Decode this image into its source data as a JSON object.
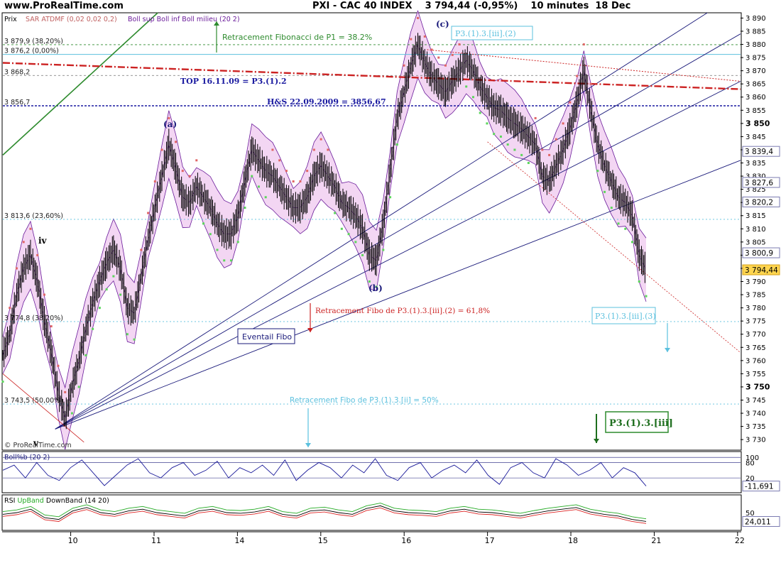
{
  "header": {
    "site": "www.ProRealTime.com",
    "instrument": "PXI - CAC 40 INDEX",
    "last": "3 794,44 (-0,95%)",
    "timeframe": "10 minutes  18 Dec"
  },
  "chart_data": [
    {
      "type": "candlestick",
      "legend": {
        "price": "Prix",
        "sar": "SAR ATDMF (0,02 0,02 0,2)",
        "boll": "Boll sup Boll inf Boll milieu (20 2)"
      },
      "ylim": [
        3726,
        3892
      ],
      "x_ticks": [
        {
          "label": "10",
          "pos": 0.092
        },
        {
          "label": "11",
          "pos": 0.205
        },
        {
          "label": "14",
          "pos": 0.318
        },
        {
          "label": "15",
          "pos": 0.431
        },
        {
          "label": "16",
          "pos": 0.544
        },
        {
          "label": "17",
          "pos": 0.657
        },
        {
          "label": "18",
          "pos": 0.77
        },
        {
          "label": "21",
          "pos": 0.883
        },
        {
          "label": "22",
          "pos": 0.996
        }
      ],
      "y_ticks": [
        "3 730",
        "3 735",
        "3 740",
        "3 745",
        "3 750",
        "3 755",
        "3 760",
        "3 765",
        "3 770",
        "3 775",
        "3 780",
        "3 785",
        "3 790",
        "3 795",
        "3 800",
        "3 805",
        "3 810",
        "3 815",
        "3 820",
        "3 825",
        "3 830",
        "3 835",
        "3 840",
        "3 845",
        "3 850",
        "3 855",
        "3 860",
        "3 865",
        "3 870",
        "3 875",
        "3 880",
        "3 885",
        "3 890"
      ],
      "y_ticks_bold": [
        "3 750",
        "3 850"
      ],
      "right_labels": [
        {
          "value": 3839.4,
          "text": "3 839,4"
        },
        {
          "value": 3827.6,
          "text": "3 827,6"
        },
        {
          "value": 3820.2,
          "text": "3 820,2"
        },
        {
          "value": 3800.9,
          "text": "3 800,9"
        },
        {
          "value": 3794.44,
          "text": "3 794,44",
          "highlight": true
        }
      ],
      "levels": [
        {
          "value": 3879.9,
          "text": "3 879,9 (38,20%)",
          "color": "#2e8b2e",
          "dash": "3,3"
        },
        {
          "value": 3876.2,
          "text": "3 876,2 (0,00%)",
          "color": "#5bc0de",
          "dash": ""
        },
        {
          "value": 3868.2,
          "text": "3 868,2",
          "color": "#888888",
          "dash": "3,3"
        },
        {
          "value": 3856.7,
          "text": "3 856,7",
          "color": "#1a1aa0",
          "dash": "3,2"
        },
        {
          "value": 3813.6,
          "text": "3 813,6 (23,60%)",
          "color": "#5bc0de",
          "dash": "2,3"
        },
        {
          "value": 3774.8,
          "text": "3 774,8 (38,20%)",
          "color": "#5bc0de",
          "dash": "2,3"
        },
        {
          "value": 3743.5,
          "text": "3 743,5 (50,00%)",
          "color": "#5bc0de",
          "dash": "2,3"
        }
      ],
      "annotations": {
        "fibo_p1": "Retracement Fibonacci de P1 = 38.2%",
        "top": "TOP 16.11.09 = P3.(1).2",
        "hs": "H&S 22.09.2009 = 3856,67",
        "fibo_618": "Retracement Fibo de P3.(1).3.[iii].(2) = 61,8%",
        "fibo_50": "Retracement Fibo de P3.(1).3.[ii] = 50%",
        "eventail": "Eventail Fibo",
        "wave_c": "(c)",
        "wave_a": "(a)",
        "wave_b": "(b)",
        "wave_iv": "iv",
        "wave_v": "v",
        "box_c": "P3.(1).3.[iii].(2)",
        "box_3": "P3.(1).3.[iii].(3)",
        "box_iii": "P3.(1).3.[iii]",
        "copyright": "© ProRealTime.com"
      },
      "series": [
        {
          "name": "Prix",
          "values": [
            3762,
            3770,
            3785,
            3795,
            3800,
            3790,
            3775,
            3763,
            3748,
            3738,
            3750,
            3760,
            3772,
            3782,
            3790,
            3797,
            3802,
            3795,
            3780,
            3778,
            3792,
            3806,
            3818,
            3830,
            3842,
            3833,
            3822,
            3820,
            3826,
            3822,
            3818,
            3812,
            3808,
            3808,
            3815,
            3828,
            3840,
            3836,
            3832,
            3830,
            3826,
            3822,
            3818,
            3818,
            3822,
            3830,
            3834,
            3830,
            3826,
            3820,
            3818,
            3815,
            3810,
            3800,
            3798,
            3812,
            3832,
            3852,
            3862,
            3872,
            3880,
            3873,
            3868,
            3865,
            3862,
            3866,
            3870,
            3874,
            3870,
            3864,
            3860,
            3856,
            3855,
            3852,
            3850,
            3848,
            3845,
            3842,
            3830,
            3828,
            3834,
            3840,
            3848,
            3858,
            3870,
            3855,
            3842,
            3834,
            3828,
            3822,
            3820,
            3815,
            3800,
            3794.44
          ]
        }
      ]
    },
    {
      "type": "line",
      "legend": "Boll%b (20 2)",
      "ylim": [
        -35,
        120
      ],
      "y_ticks": [
        "100",
        "80",
        "20"
      ],
      "right_labels": [
        "80",
        "20",
        "-11,691"
      ],
      "values": [
        50,
        70,
        20,
        80,
        30,
        10,
        60,
        90,
        40,
        -10,
        30,
        70,
        95,
        40,
        20,
        60,
        80,
        30,
        50,
        85,
        20,
        60,
        40,
        70,
        30,
        90,
        10,
        50,
        80,
        60,
        20,
        70,
        40,
        95,
        30,
        10,
        60,
        80,
        20,
        50,
        70,
        40,
        90,
        30,
        -5,
        60,
        80,
        40,
        20,
        95,
        70,
        30,
        50,
        80,
        20,
        60,
        40,
        -11.691
      ]
    },
    {
      "type": "line",
      "legend": {
        "name": "RSI",
        "up": "UpBand",
        "down": "DownBand",
        "params": "(14 20)"
      },
      "ylim": [
        0,
        100
      ],
      "y_ticks": [
        "50"
      ],
      "right_labels": [
        "24,011"
      ],
      "values": [
        45,
        50,
        60,
        35,
        30,
        55,
        65,
        50,
        45,
        55,
        60,
        50,
        45,
        40,
        55,
        60,
        50,
        48,
        52,
        60,
        45,
        40,
        55,
        58,
        50,
        45,
        62,
        70,
        55,
        50,
        48,
        45,
        55,
        60,
        52,
        50,
        45,
        40,
        48,
        55,
        60,
        65,
        52,
        45,
        40,
        30,
        24.011
      ]
    }
  ],
  "colors": {
    "candle": "#000000",
    "sar_up": "#5cd65c",
    "sar_down": "#e06666",
    "boll_fill": "#f3d6f3",
    "boll_line": "#6a1b9a",
    "fan": "#1a1a7a",
    "trend_red": "#cc2222",
    "fibo_green": "#2e8b2e",
    "cyan": "#5bc0de",
    "rsi_up": "#22aa22",
    "rsi_down": "#dd2222"
  }
}
